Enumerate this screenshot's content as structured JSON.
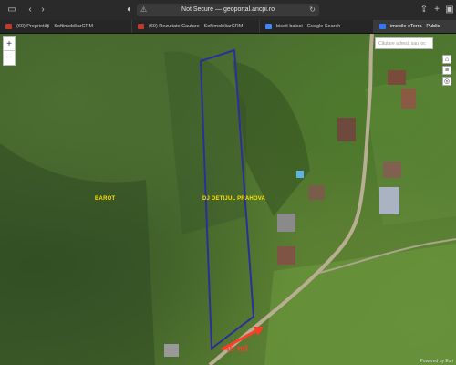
{
  "browser": {
    "url": "geoportal.ancpi.ro",
    "security": "Not Secure — ",
    "tabs": [
      {
        "label": "(60) Proprietăți - SoftimobiliarCRM",
        "color": "#c0392b"
      },
      {
        "label": "(60) Rezultate Cautare - SoftimobiliarCRM",
        "color": "#c0392b"
      },
      {
        "label": "bisoit baisoi - Google Search",
        "color": "#4285f4"
      },
      {
        "label": "imobile eTerra - Public",
        "color": "#3478f6"
      }
    ]
  },
  "map": {
    "search_placeholder": "Căutare adresă sau loc",
    "zoom_in": "+",
    "zoom_out": "−",
    "labels": {
      "parcel": "BAROT",
      "street": "DJ DETIJUL PRAHOVA"
    },
    "distance": "45 ml",
    "credit": "Powered by Esri",
    "colors": {
      "parcel_outline": "#2b2f9c",
      "arrow": "#ff3b2a",
      "label": "#ffe000"
    }
  }
}
